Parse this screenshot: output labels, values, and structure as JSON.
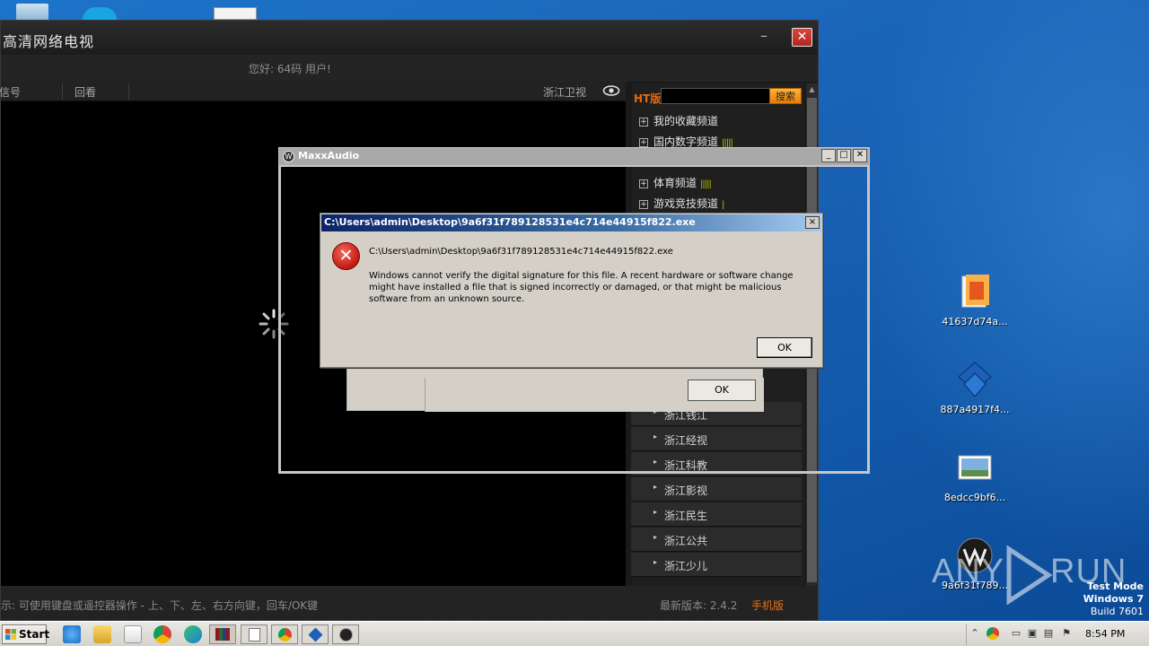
{
  "tv_app": {
    "title": "高清网络电视",
    "greeting": "您好: 64码 用户!",
    "tabs": [
      "信号",
      "回看"
    ],
    "current_channel": "浙江卫视",
    "ht_label": "HT版",
    "search_button": "搜索",
    "categories": [
      {
        "label": "我的收藏频道",
        "bars": ""
      },
      {
        "label": "国内数字频道",
        "bars": "|||||"
      },
      {
        "label": "体育频道",
        "bars": "|||||"
      },
      {
        "label": "游戏竞技频道",
        "bars": "|"
      }
    ],
    "channels": [
      "浙江钱江",
      "浙江经视",
      "浙江科教",
      "浙江影视",
      "浙江民生",
      "浙江公共",
      "浙江少儿"
    ],
    "hint": "示: 可使用键盘或遥控器操作 - 上、下、左、右方向键，回车/OK键",
    "version": "最新版本: 2.4.2",
    "mobile": "手机版"
  },
  "maxx_audio": {
    "title": "MaxxAudio",
    "icon": "waves-logo-icon"
  },
  "behind_dialog": {
    "ok_label": "OK"
  },
  "error_dialog": {
    "title": "C:\\Users\\admin\\Desktop\\9a6f31f789128531e4c714e44915f822.exe",
    "path": "C:\\Users\\admin\\Desktop\\9a6f31f789128531e4c714e44915f822.exe",
    "message": "Windows cannot verify the digital signature for this file. A recent hardware or software change might have installed a file that is signed incorrectly or damaged, or that might be malicious software from an unknown source.",
    "ok_label": "OK",
    "close_label": "×",
    "icon": "error-x-icon"
  },
  "desktop_icons": [
    {
      "label": "41637d74a...",
      "icon": "document-orange-icon"
    },
    {
      "label": "887a4917f4...",
      "icon": "blue-diamond-app-icon"
    },
    {
      "label": "8edcc9bf6...",
      "icon": "image-file-icon"
    },
    {
      "label": "9a6f31f789...",
      "icon": "waves-logo-icon"
    }
  ],
  "watermark": {
    "left": "ANY",
    "right": "RUN"
  },
  "test_mode": {
    "line1": "Test Mode",
    "line2": "Windows 7",
    "line3": "Build 7601"
  },
  "taskbar": {
    "start_label": "Start",
    "clock": "8:54 PM"
  },
  "colors": {
    "accent_orange": "#e8700f",
    "error_red": "#c4170f",
    "desktop_blue": "#1a62b5"
  }
}
